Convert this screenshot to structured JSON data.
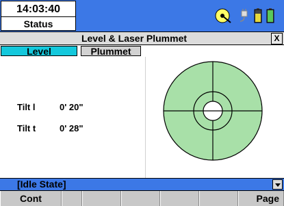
{
  "header": {
    "time": "14:03:40",
    "status_tab": "Status"
  },
  "title_bar": {
    "title": "Level & Laser Plummet",
    "close_label": "X"
  },
  "tabs": [
    {
      "label": "Level",
      "active": true
    },
    {
      "label": "Plummet",
      "active": false
    }
  ],
  "readings": [
    {
      "label": "Tilt l",
      "value": "0' 20\""
    },
    {
      "label": "Tilt t",
      "value": "0' 28\""
    }
  ],
  "status_bar": {
    "state": "[Idle State]"
  },
  "softkeys": [
    "Cont",
    "",
    "",
    "",
    "",
    "",
    "Page"
  ],
  "icons": [
    "bubble-level-icon",
    "power-plug-icon",
    "battery-icon",
    "battery-full-icon"
  ],
  "colors": {
    "accent": "#3c78e6",
    "active_tab": "#14c8dc",
    "bubble_fill": "#a8e0a8"
  }
}
